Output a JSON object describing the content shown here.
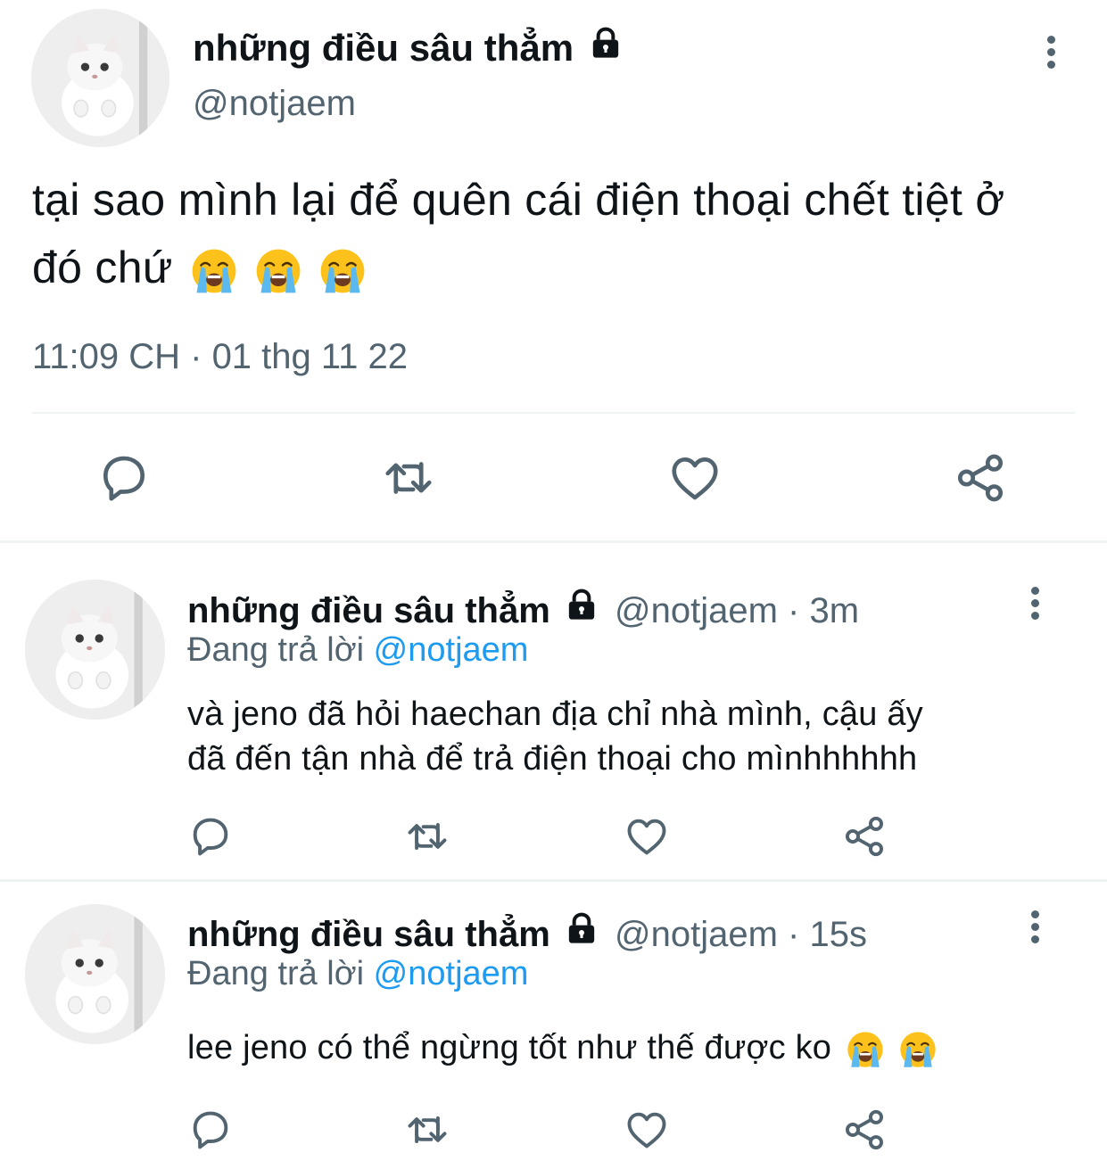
{
  "colors": {
    "text": "#0f1419",
    "secondary": "#536471",
    "link": "#1d9bf0",
    "divider": "#eff3f4",
    "icon": "#536471"
  },
  "main_tweet": {
    "author_name": "những điều sâu thẳm",
    "handle": "@notjaem",
    "text": "tại sao mình lại để quên cái điện thoại chết tiệt ở đó chứ",
    "emoji": [
      "loudly-crying-face",
      "loudly-crying-face",
      "loudly-crying-face"
    ],
    "timestamp": "11:09 CH · 01 thg 11 22",
    "actions": [
      "reply-icon",
      "retweet-icon",
      "like-icon",
      "share-icon"
    ]
  },
  "replies": [
    {
      "author_name": "những điều sâu thẳm",
      "handle_time": "@notjaem · 3m",
      "replying_label": "Đang trả lời",
      "replying_to": "@notjaem",
      "text_line1": "và jeno đã hỏi haechan địa chỉ nhà mình, cậu ấy",
      "text_line2": "đã đến tận nhà để trả điện thoại cho mìnhhhhhh"
    },
    {
      "author_name": "những điều sâu thẳm",
      "handle_time": "@notjaem · 15s",
      "replying_label": "Đang trả lời",
      "replying_to": "@notjaem",
      "text": "lee jeno có thể ngừng tốt như thế được ko",
      "emoji": [
        "loudly-crying-face",
        "loudly-crying-face"
      ]
    }
  ]
}
